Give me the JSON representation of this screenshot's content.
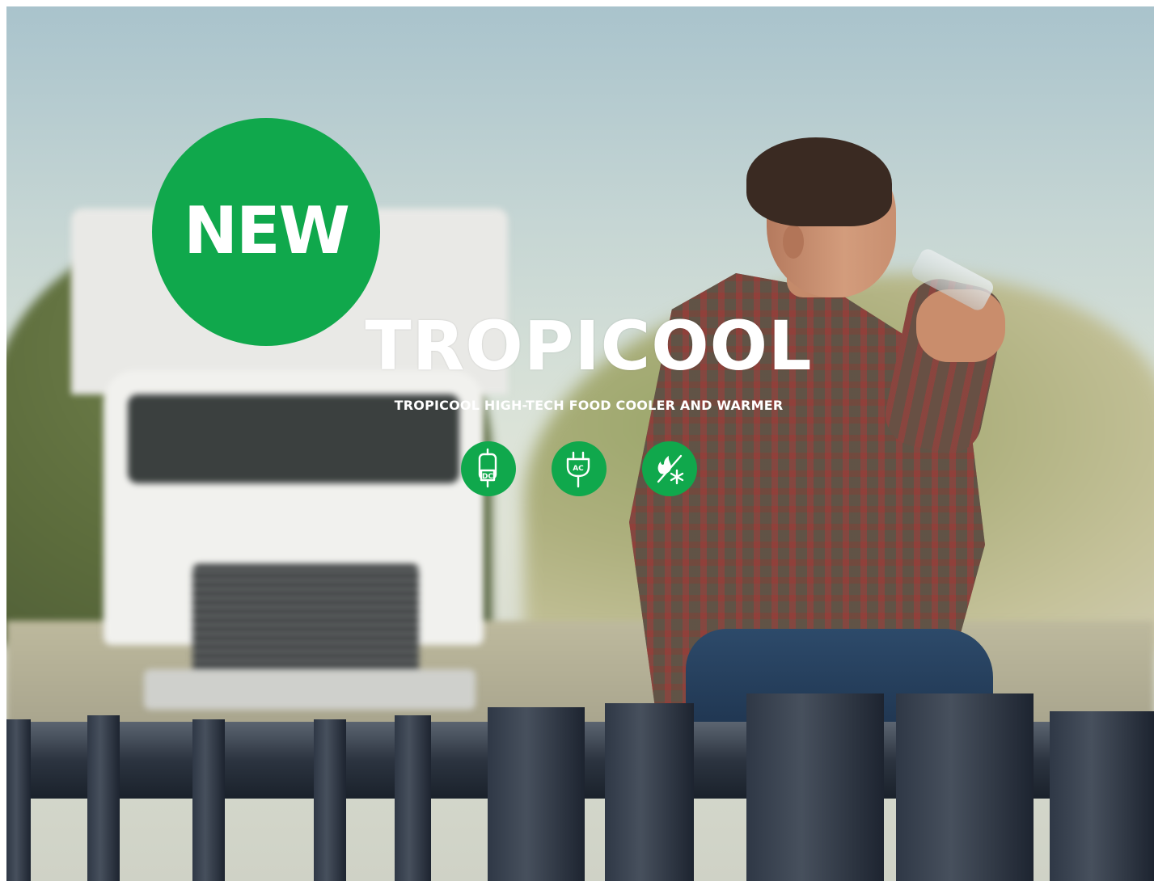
{
  "badge": {
    "text": "NEW",
    "color": "#10a84c"
  },
  "product": {
    "title": "TROPICOOL",
    "subtitle": "TROPICOOL HIGH-TECH FOOD COOLER AND WARMER"
  },
  "features": [
    {
      "icon": "dc-power-icon",
      "label": "DC"
    },
    {
      "icon": "ac-plug-icon",
      "label": "AC"
    },
    {
      "icon": "heat-cool-icon"
    }
  ],
  "colors": {
    "accent": "#10a84c",
    "text": "#ffffff"
  }
}
